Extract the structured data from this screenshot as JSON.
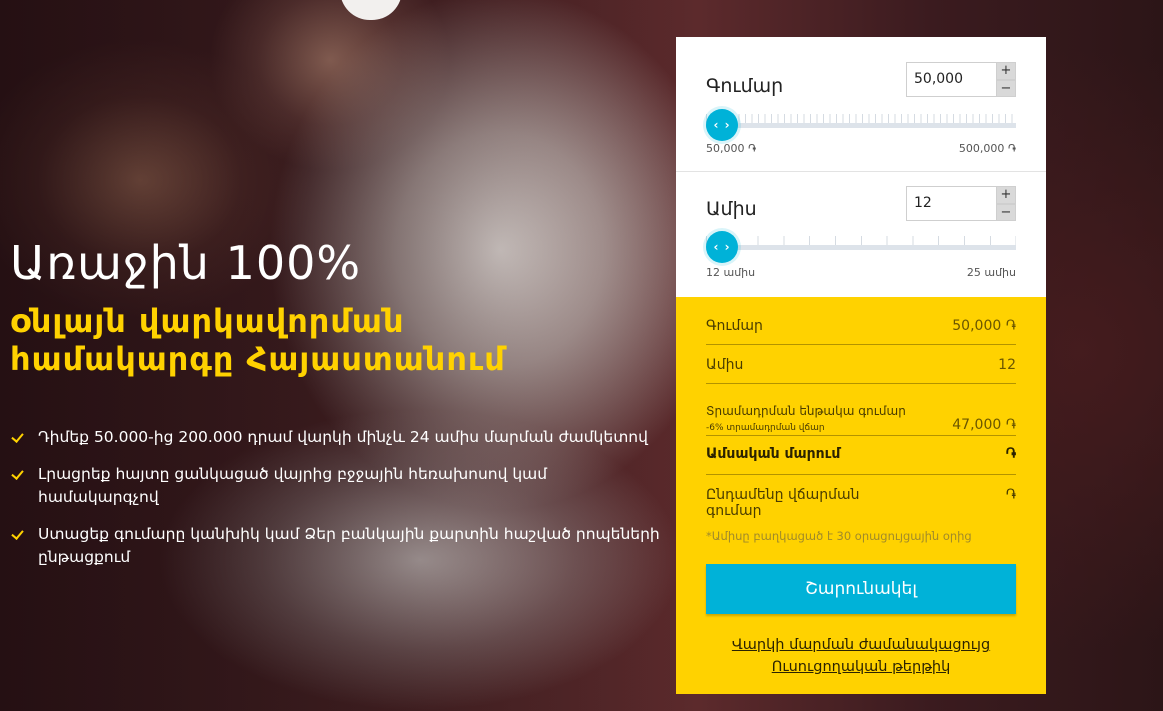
{
  "hero": {
    "title": "Առաջին 100%",
    "subtitle_line1": "օնլայն վարկավորման",
    "subtitle_line2": "համակարգը Հայաստանում",
    "benefits": [
      "Դիմեք 50.000-ից 200.000 դրամ վարկի մինչև 24 ամիս մարման ժամկետով",
      "Լրացրեք հայտը ցանկացած վայրից բջջային հեռախոսով կամ համակարգչով",
      "Ստացեք գումարը կանխիկ կամ Ձեր բանկային քարտին հաշված րոպեների ընթացքում"
    ]
  },
  "calculator": {
    "amount": {
      "label": "Գումար",
      "value": "50,000",
      "plus": "+",
      "minus": "−",
      "handle": "‹ ›",
      "min_label": "50,000 ֏",
      "max_label": "500,000 ֏",
      "slider_fraction": 0
    },
    "months": {
      "label": "Ամիս",
      "value": "12",
      "plus": "+",
      "minus": "−",
      "handle": "‹ ›",
      "min_label": "12 ամիս",
      "max_label": "25 ամիս",
      "slider_fraction": 0
    },
    "summary": {
      "amount_label": "Գումար",
      "amount_value": "50,000 ֏",
      "months_label": "Ամիս",
      "months_value": "12",
      "disbursed_label": "Տրամադրման ենթակա գումար",
      "disbursed_sublabel": "-6% տրամադրման վճար",
      "disbursed_value": "47,000 ֏",
      "monthly_label": "Ամսական մարում",
      "monthly_value": "֏",
      "total_label": "Ընդամենը վճարման գումար",
      "total_value": "֏",
      "footnote": "*Ամիսը բաղկացած է 30 օրացույցային օրից",
      "submit_label": "Շարունակել",
      "link_schedule": "Վարկի մարման ժամանակացույց",
      "link_info": "Ուսուցողական թերթիկ"
    }
  },
  "colors": {
    "accent_yellow": "#ffd200",
    "accent_blue": "#00b2d8"
  }
}
